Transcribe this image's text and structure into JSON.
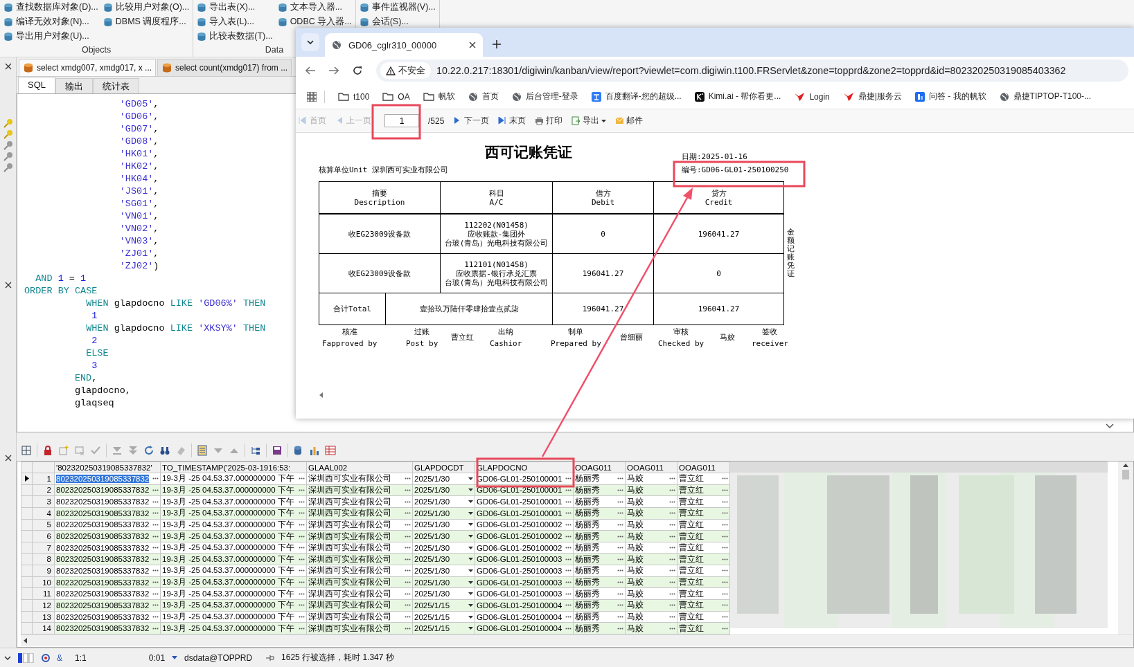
{
  "ribbon": {
    "groups": [
      {
        "label": "Objects",
        "columns": [
          [
            "查找数据库对象(D)...",
            "编译无效对象(N)...",
            "导出用户对象(U)..."
          ],
          [
            "比较用户对象(O)...",
            "DBMS 调度程序..."
          ]
        ]
      },
      {
        "label": "Data",
        "columns": [
          [
            "导出表(X)...",
            "导入表(L)...",
            "比较表数据(T)..."
          ],
          [
            "文本导入器...",
            "ODBC 导入器..."
          ]
        ]
      },
      {
        "columns": [
          [
            "事件监视器(V)...",
            "会话(S)..."
          ]
        ]
      }
    ]
  },
  "editor": {
    "tabs": [
      {
        "label": "select xmdg007, xmdg017, x ...",
        "selected": true
      },
      {
        "label": "select count(xmdg017) from ...",
        "selected": false
      }
    ],
    "subtabs": [
      {
        "label": "SQL",
        "selected": true
      },
      {
        "label": "输出",
        "selected": false
      },
      {
        "label": "统计表",
        "selected": false
      }
    ],
    "code": [
      "                 'GD05',",
      "                 'GD06',",
      "                 'GD07',",
      "                 'GD08',",
      "                 'HK01',",
      "                 'HK02',",
      "                 'HK04',",
      "                 'JS01',",
      "                 'SG01',",
      "                 'VN01',",
      "                 'VN02',",
      "                 'VN03',",
      "                 'ZJ01',",
      "                 'ZJ02')",
      "  AND 1 = 1",
      "ORDER BY CASE",
      "           WHEN glapdocno LIKE 'GD06%' THEN",
      "            1",
      "           WHEN glapdocno LIKE 'XKSY%' THEN",
      "            2",
      "           ELSE",
      "            3",
      "         END,",
      "         glapdocno,",
      "         glaqseq"
    ]
  },
  "browser": {
    "tab": {
      "title": "GD06_cglr310_00000"
    },
    "security": "不安全",
    "url": "10.22.0.217:18301/digiwin/kanban/view/report?viewlet=com.digiwin.t100.FRServlet&zone=topprd&zone2=topprd&id=802320250319085403362",
    "bookmarks": [
      {
        "kind": "folder",
        "label": "t100"
      },
      {
        "kind": "folder",
        "label": "OA"
      },
      {
        "kind": "folder",
        "label": "帆软"
      },
      {
        "kind": "globe",
        "label": "首页"
      },
      {
        "kind": "globe",
        "label": "后台管理-登录"
      },
      {
        "kind": "translate",
        "label": "百度翻译-您的超级..."
      },
      {
        "kind": "dark-app",
        "label": "Kimi.ai - 帮你看更..."
      },
      {
        "kind": "bird",
        "label": "Login"
      },
      {
        "kind": "bird",
        "label": "鼎捷|服务云"
      },
      {
        "kind": "blue-app",
        "label": "问答 - 我的帆软"
      },
      {
        "kind": "globe",
        "label": "鼎捷TIPTOP-T100-..."
      }
    ],
    "report_toolbar": [
      {
        "kind": "first",
        "label": "首页",
        "disabled": true
      },
      {
        "kind": "prev",
        "label": "上一页",
        "disabled": true
      },
      {
        "kind": "page",
        "value": "1",
        "total": "/525"
      },
      {
        "kind": "next",
        "label": "下一页",
        "disabled": false
      },
      {
        "kind": "last",
        "label": "末页",
        "disabled": false
      },
      {
        "kind": "print",
        "label": "打印",
        "disabled": false
      },
      {
        "kind": "export",
        "label": "导出",
        "disabled": false
      },
      {
        "kind": "mail",
        "label": "邮件",
        "disabled": false
      }
    ]
  },
  "voucher": {
    "title": "西可记账凭证",
    "date": "日期:2025-01-16",
    "unit": "核算单位Unit 深圳西可实业有限公司",
    "number": "编号:GD06-GL01-250100250",
    "headers": [
      {
        "zh": "摘要",
        "en": "Description"
      },
      {
        "zh": "科目",
        "en": "A/C"
      },
      {
        "zh": "借方",
        "en": "Debit"
      },
      {
        "zh": "贷方",
        "en": "Credit"
      }
    ],
    "rows": [
      {
        "description": "收EG23009设备款",
        "account": [
          "112202(N01458)",
          "应收账款-集团外",
          "台玻(青岛）光电科技有限公司"
        ],
        "debit": "0",
        "credit": "196041.27"
      },
      {
        "description": "收EG23009设备款",
        "account": [
          "112101(N01458)",
          "应收票据-银行承兑汇票",
          "台玻(青岛）光电科技有限公司"
        ],
        "debit": "196041.27",
        "credit": "0"
      }
    ],
    "total": {
      "label": "合计Total",
      "words": "壹拾玖万陆仟零肆拾壹点贰柒",
      "debit": "196041.27",
      "credit": "196041.27"
    },
    "side_label": "金额记账凭证",
    "signatures": [
      {
        "zh": "核准",
        "en": "Fapproved by"
      },
      {
        "zh": "过账",
        "en": "Post by",
        "name": "曹立红"
      },
      {
        "zh": "出纳",
        "en": "Cashior"
      },
      {
        "zh": "制单",
        "en": "Prepared by",
        "name": "曾细丽"
      },
      {
        "zh": "审核",
        "en": "Checked by",
        "name": "马姣"
      },
      {
        "zh": "签收",
        "en": "receiver"
      }
    ]
  },
  "grid": {
    "columns": [
      {
        "label": "'802320250319085337832'",
        "kind": "text"
      },
      {
        "label": "TO_TIMESTAMP('2025-03-1916:53:",
        "kind": "text"
      },
      {
        "label": "GLAAL002",
        "kind": "text"
      },
      {
        "label": "GLAPDOCDT",
        "kind": "date"
      },
      {
        "label": "GLAPDOCNO",
        "kind": "text"
      },
      {
        "label": "OOAG011",
        "kind": "text"
      },
      {
        "label": "OOAG011",
        "kind": "text"
      },
      {
        "label": "OOAG011",
        "kind": "text"
      }
    ],
    "rows": [
      {
        "num": "1",
        "selected": true,
        "cells": [
          "802320250319085337832",
          "19-3月 -25 04.53.37.000000000 下午",
          "深圳西可实业有限公司",
          "2025/1/30",
          "GD06-GL01-250100001",
          "杨丽秀",
          "马姣",
          "曹立红"
        ]
      },
      {
        "num": "2",
        "selected": false,
        "cells": [
          "802320250319085337832",
          "19-3月 -25 04.53.37.000000000 下午",
          "深圳西可实业有限公司",
          "2025/1/30",
          "GD06-GL01-250100001",
          "杨丽秀",
          "马姣",
          "曹立红"
        ]
      },
      {
        "num": "3",
        "selected": false,
        "cells": [
          "802320250319085337832",
          "19-3月 -25 04.53.37.000000000 下午",
          "深圳西可实业有限公司",
          "2025/1/30",
          "GD06-GL01-250100001",
          "杨丽秀",
          "马姣",
          "曹立红"
        ]
      },
      {
        "num": "4",
        "selected": false,
        "cells": [
          "802320250319085337832",
          "19-3月 -25 04.53.37.000000000 下午",
          "深圳西可实业有限公司",
          "2025/1/30",
          "GD06-GL01-250100001",
          "杨丽秀",
          "马姣",
          "曹立红"
        ]
      },
      {
        "num": "5",
        "selected": false,
        "cells": [
          "802320250319085337832",
          "19-3月 -25 04.53.37.000000000 下午",
          "深圳西可实业有限公司",
          "2025/1/30",
          "GD06-GL01-250100002",
          "杨丽秀",
          "马姣",
          "曹立红"
        ]
      },
      {
        "num": "6",
        "selected": false,
        "cells": [
          "802320250319085337832",
          "19-3月 -25 04.53.37.000000000 下午",
          "深圳西可实业有限公司",
          "2025/1/30",
          "GD06-GL01-250100002",
          "杨丽秀",
          "马姣",
          "曹立红"
        ]
      },
      {
        "num": "7",
        "selected": false,
        "cells": [
          "802320250319085337832",
          "19-3月 -25 04.53.37.000000000 下午",
          "深圳西可实业有限公司",
          "2025/1/30",
          "GD06-GL01-250100002",
          "杨丽秀",
          "马姣",
          "曹立红"
        ]
      },
      {
        "num": "8",
        "selected": false,
        "cells": [
          "802320250319085337832",
          "19-3月 -25 04.53.37.000000000 下午",
          "深圳西可实业有限公司",
          "2025/1/30",
          "GD06-GL01-250100003",
          "杨丽秀",
          "马姣",
          "曹立红"
        ]
      },
      {
        "num": "9",
        "selected": false,
        "cells": [
          "802320250319085337832",
          "19-3月 -25 04.53.37.000000000 下午",
          "深圳西可实业有限公司",
          "2025/1/30",
          "GD06-GL01-250100003",
          "杨丽秀",
          "马姣",
          "曹立红"
        ]
      },
      {
        "num": "10",
        "selected": false,
        "cells": [
          "802320250319085337832",
          "19-3月 -25 04.53.37.000000000 下午",
          "深圳西可实业有限公司",
          "2025/1/30",
          "GD06-GL01-250100003",
          "杨丽秀",
          "马姣",
          "曹立红"
        ]
      },
      {
        "num": "11",
        "selected": false,
        "cells": [
          "802320250319085337832",
          "19-3月 -25 04.53.37.000000000 下午",
          "深圳西可实业有限公司",
          "2025/1/30",
          "GD06-GL01-250100003",
          "杨丽秀",
          "马姣",
          "曹立红"
        ]
      },
      {
        "num": "12",
        "selected": false,
        "cells": [
          "802320250319085337832",
          "19-3月 -25 04.53.37.000000000 下午",
          "深圳西可实业有限公司",
          "2025/1/15",
          "GD06-GL01-250100004",
          "杨丽秀",
          "马姣",
          "曹立红"
        ]
      },
      {
        "num": "13",
        "selected": false,
        "cells": [
          "802320250319085337832",
          "19-3月 -25 04.53.37.000000000 下午",
          "深圳西可实业有限公司",
          "2025/1/15",
          "GD06-GL01-250100004",
          "杨丽秀",
          "马姣",
          "曹立红"
        ]
      },
      {
        "num": "14",
        "selected": false,
        "cells": [
          "802320250319085337832",
          "19-3月 -25 04.53.37.000000000 下午",
          "深圳西可实业有限公司",
          "2025/1/15",
          "GD06-GL01-250100004",
          "杨丽秀",
          "马姣",
          "曹立红"
        ]
      }
    ]
  },
  "status_bar": {
    "symbol": "&",
    "position": "1:1",
    "time": "0:01",
    "connection": "dsdata@TOPPRD",
    "message": "1625 行被选择，耗时 1.347 秒"
  }
}
